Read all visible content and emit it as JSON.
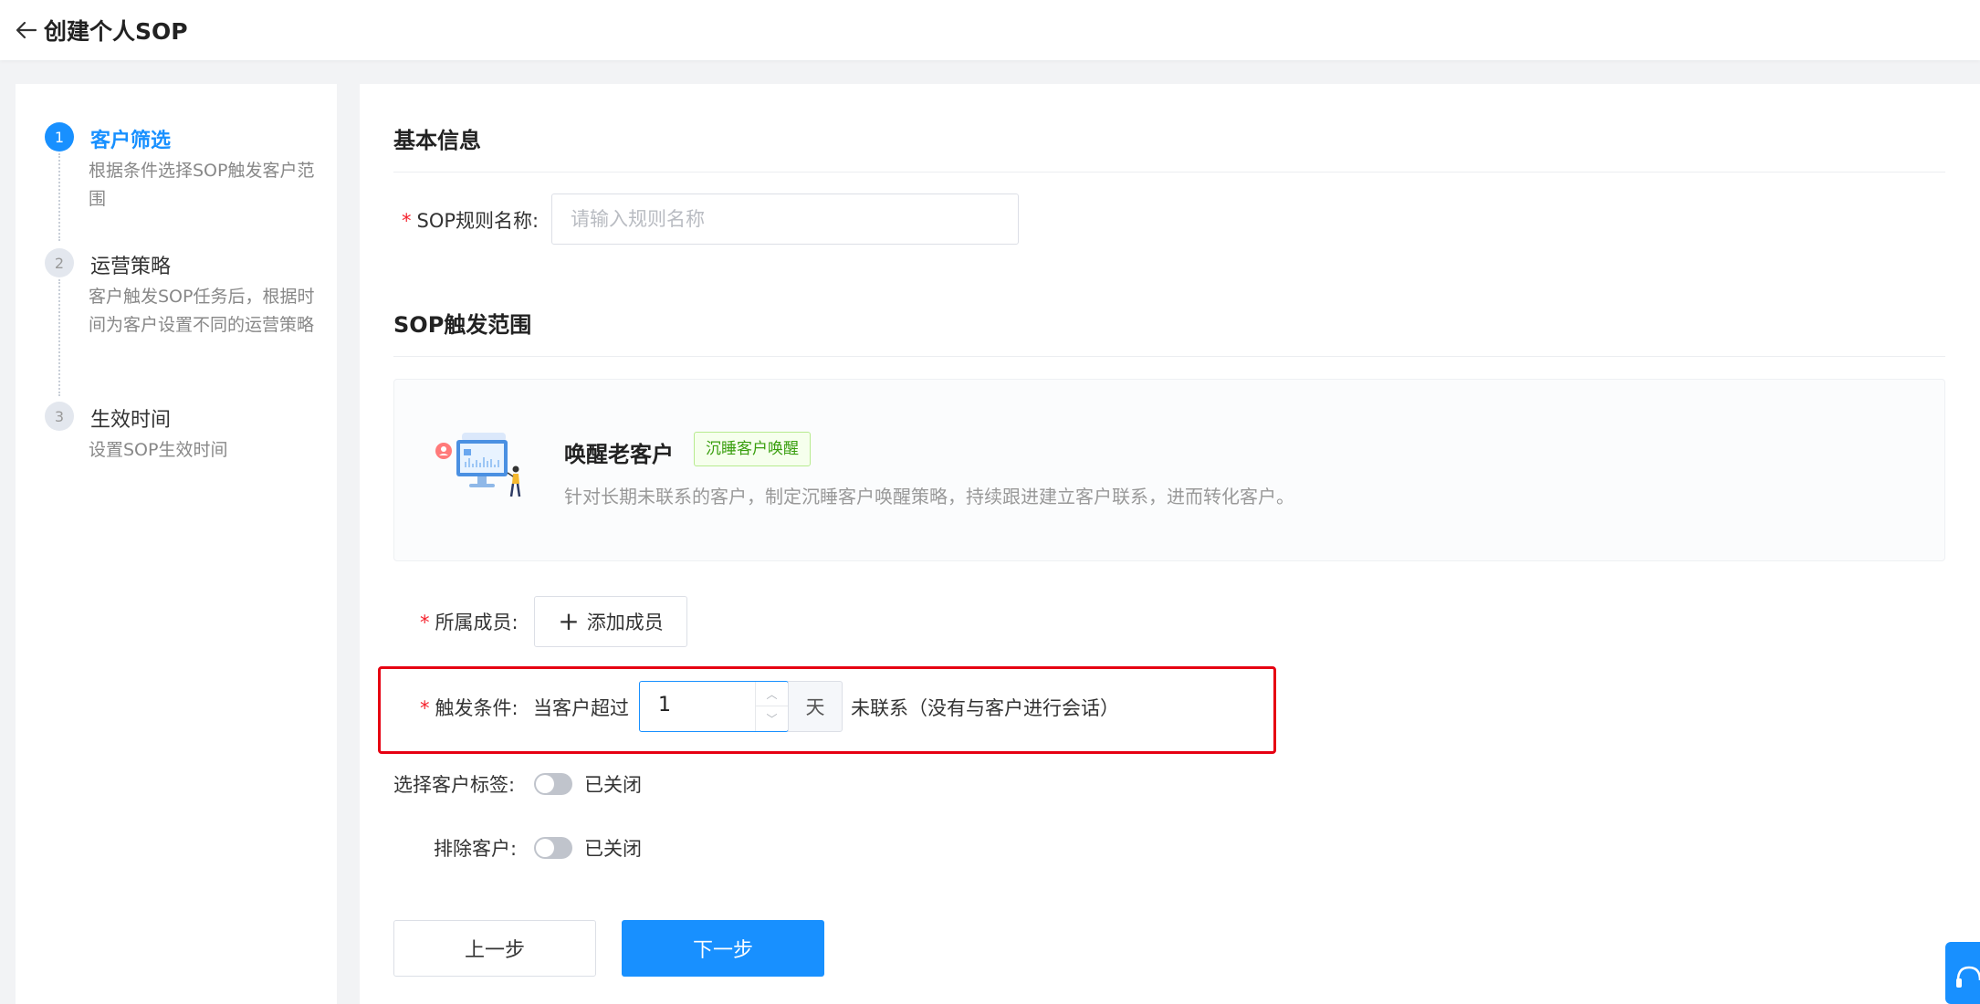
{
  "header": {
    "title": "创建个人SOP"
  },
  "steps": [
    {
      "num": "1",
      "title": "客户筛选",
      "desc": "根据条件选择SOP触发客户范围"
    },
    {
      "num": "2",
      "title": "运营策略",
      "desc": "客户触发SOP任务后，根据时间为客户设置不同的运营策略"
    },
    {
      "num": "3",
      "title": "生效时间",
      "desc": "设置SOP生效时间"
    }
  ],
  "basic": {
    "section_title": "基本信息",
    "name_label": "SOP规则名称:",
    "name_placeholder": "请输入规则名称",
    "required_mark": "*"
  },
  "scope": {
    "section_title": "SOP触发范围",
    "card_name": "唤醒老客户",
    "card_tag": "沉睡客户唤醒",
    "card_desc": "针对长期未联系的客户，制定沉睡客户唤醒策略，持续跟进建立客户联系，进而转化客户。"
  },
  "members": {
    "label": "所属成员:",
    "button": "添加成员"
  },
  "trigger": {
    "label": "触发条件:",
    "prefix": "当客户超过",
    "value": "1",
    "unit": "天",
    "suffix": "未联系（没有与客户进行会话）"
  },
  "tags_filter": {
    "label": "选择客户标签:",
    "state": "已关闭"
  },
  "exclude": {
    "label": "排除客户:",
    "state": "已关闭"
  },
  "actions": {
    "prev": "上一步",
    "next": "下一步"
  },
  "colors": {
    "primary": "#1890ff",
    "required": "#f5222d",
    "highlight": "#e60012"
  }
}
